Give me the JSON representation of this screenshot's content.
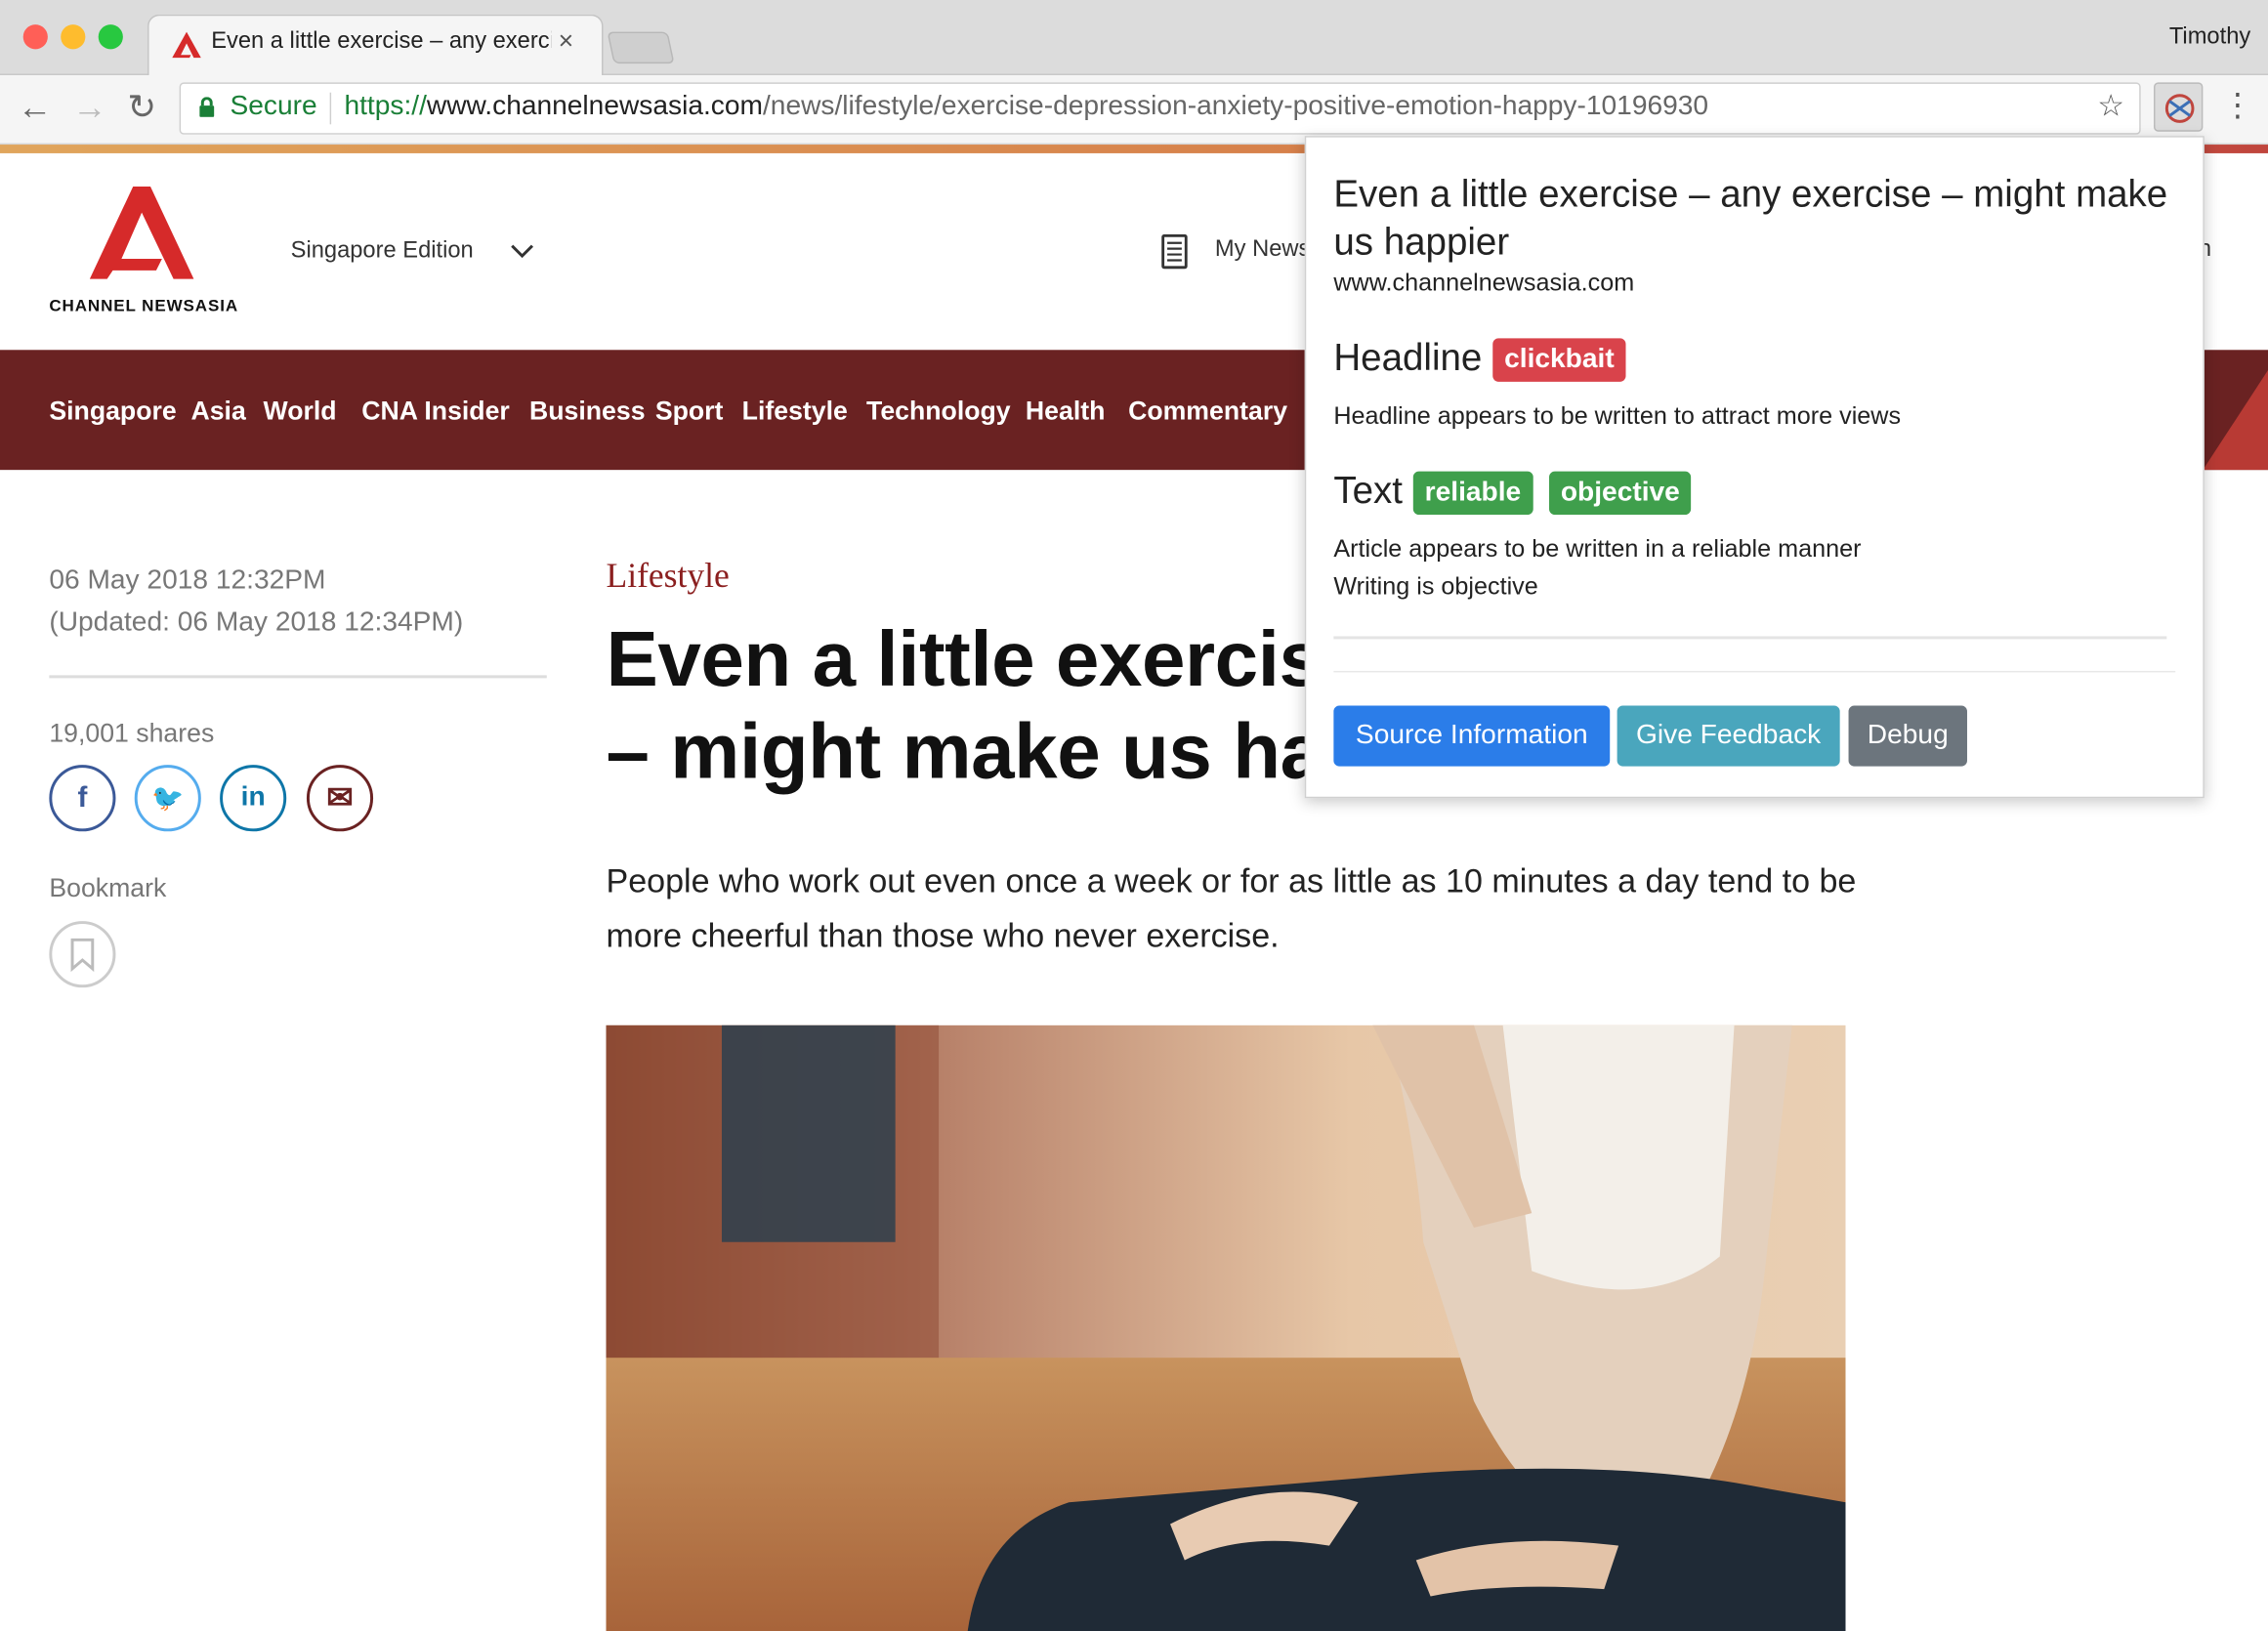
{
  "browser": {
    "tab_title": "Even a little exercise – any exercise – might make us happier",
    "tab_close": "×",
    "user_name": "Timothy",
    "secure_label": "Secure",
    "url_scheme": "https://",
    "url_host": "www.channelnewsasia.com",
    "url_path": "/news/lifestyle/exercise-depression-anxiety-positive-emotion-happy-10196930",
    "colors": {
      "close": "#ff5f57",
      "minimize": "#febc2e",
      "maximize": "#28c840",
      "secure": "#1a7f37"
    }
  },
  "site": {
    "logo_text": "CHANNEL NEWSASIA",
    "edition": "Singapore Edition",
    "my_news": "My News",
    "search_fragment": "h",
    "nav": [
      "Singapore",
      "Asia",
      "World",
      "CNA Insider",
      "Business",
      "Sport",
      "Lifestyle",
      "Technology",
      "Health",
      "Commentary"
    ],
    "colors": {
      "nav_bg": "#6a2222",
      "logo_red": "#d62a2a",
      "category": "#8b1f1f"
    }
  },
  "article": {
    "date": "06 May 2018 12:32PM",
    "updated": "(Updated: 06 May 2018 12:34PM)",
    "shares": "19,001 shares",
    "bookmark_label": "Bookmark",
    "category": "Lifestyle",
    "headline_line1": "Even a little exercise",
    "headline_line2": "– might make us hap",
    "deck": "People who work out even once a week or for as little as 10 minutes a day tend to be more cheerful than those who never exercise.",
    "social": [
      {
        "name": "facebook",
        "glyph": "f",
        "color": "#3b5998"
      },
      {
        "name": "twitter",
        "glyph": "🐦",
        "color": "#55acee"
      },
      {
        "name": "linkedin",
        "glyph": "in",
        "color": "#0e76a8"
      },
      {
        "name": "email",
        "glyph": "✉",
        "color": "#6a2222"
      }
    ]
  },
  "popup": {
    "title": "Even a little exercise – any exercise – might make us happier",
    "domain": "www.channelnewsasia.com",
    "headline_label": "Headline",
    "headline_badges": [
      "clickbait"
    ],
    "headline_notes": [
      "Headline appears to be written to attract more views"
    ],
    "text_label": "Text",
    "text_badges": [
      "reliable",
      "objective"
    ],
    "text_notes": [
      "Article appears to be written in a reliable manner",
      "Writing is objective"
    ],
    "buttons": {
      "source": "Source Information",
      "feedback": "Give Feedback",
      "debug": "Debug"
    },
    "colors": {
      "clickbait": "#d9434b",
      "reliable": "#3f9f4c",
      "objective": "#3f9f4c",
      "source_btn": "#2b7de9",
      "feedback_btn": "#4aa6bd",
      "debug_btn": "#6c757d"
    }
  }
}
